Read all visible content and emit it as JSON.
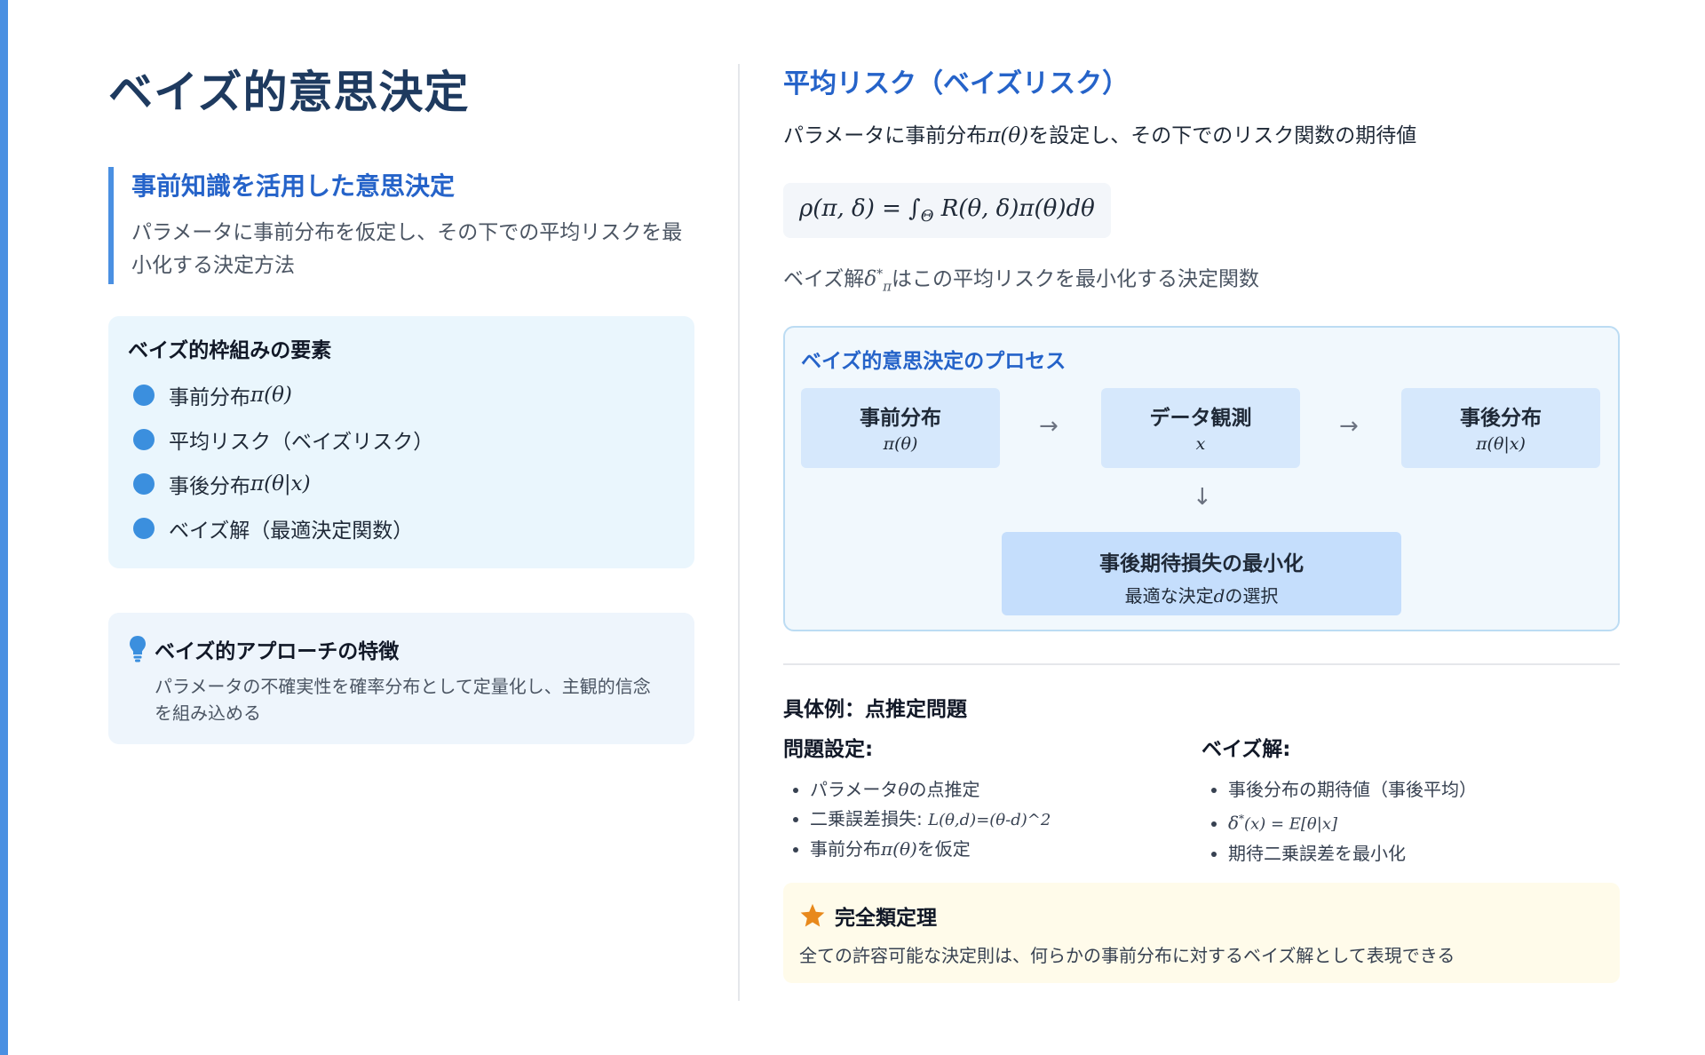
{
  "left": {
    "title": "ベイズ的意思決定",
    "lead": {
      "title": "事前知識を活用した意思決定",
      "desc": "パラメータに事前分布を仮定し、その下での平均リスクを最小化する決定方法"
    },
    "elements": {
      "title": "ベイズ的枠組みの要素",
      "items": [
        {
          "label": "事前分布 ",
          "math": "π(θ)"
        },
        {
          "label": "平均リスク（ベイズリスク）",
          "math": ""
        },
        {
          "label": "事後分布 ",
          "math": "π(θ|x)"
        },
        {
          "label": "ベイズ解（最適決定関数）",
          "math": ""
        }
      ]
    },
    "feature": {
      "icon": "lightbulb-icon",
      "title": "ベイズ的アプローチの特徴",
      "desc": "パラメータの不確実性を確率分布として定量化し、主観的信念を組み込める"
    }
  },
  "right": {
    "title": "平均リスク（ベイズリスク）",
    "desc_pre": "パラメータに事前分布",
    "desc_math": "π(θ)",
    "desc_post": "を設定し、その下でのリスク関数の期待値",
    "formula_lhs": "ρ(π, δ) = ∫",
    "formula_sub": "Θ",
    "formula_rhs": " R(θ, δ)π(θ)dθ",
    "bayes_pre": "ベイズ解",
    "bayes_delta": "δ",
    "bayes_sup": "*",
    "bayes_sub": "π",
    "bayes_post": "はこの平均リスクを最小化する決定関数",
    "process": {
      "title": "ベイズ的意思決定のプロセス",
      "steps": [
        {
          "label": "事前分布",
          "sym": "π(θ)"
        },
        {
          "label": "データ観測",
          "sym": "x"
        },
        {
          "label": "事後分布",
          "sym": "π(θ|x)"
        }
      ],
      "arrow": "→",
      "arrow_down": "↓",
      "result": {
        "label": "事後期待損失の最小化",
        "sub_pre": "最適な決定",
        "sub_math": "d",
        "sub_post": "の選択"
      }
    },
    "example": {
      "title": "具体例：点推定問題",
      "setting": {
        "title": "問題設定:",
        "i1_pre": "パラメータ",
        "i1_math": "θ",
        "i1_post": "の点推定",
        "i2_pre": "二乗誤差損失: ",
        "i2_math": "L(θ,d)=(θ-d)^2",
        "i3_pre": "事前分布",
        "i3_math": "π(θ)",
        "i3_post": "を仮定"
      },
      "solution": {
        "title": "ベイズ解:",
        "i1": "事後分布の期待値（事後平均）",
        "i2_delta": "δ",
        "i2_sup": "*",
        "i2_rest": "(x) = E[θ|x]",
        "i3": "期待二乗誤差を最小化"
      }
    },
    "theorem": {
      "icon": "star-icon",
      "title": "完全類定理",
      "desc": "全ての許容可能な決定則は、何らかの事前分布に対するベイズ解として表現できる"
    }
  },
  "colors": {
    "accent": "#4a90e2",
    "title_dark": "#1e3a5f",
    "heading_blue": "#2563c9",
    "star": "#e8891c"
  }
}
